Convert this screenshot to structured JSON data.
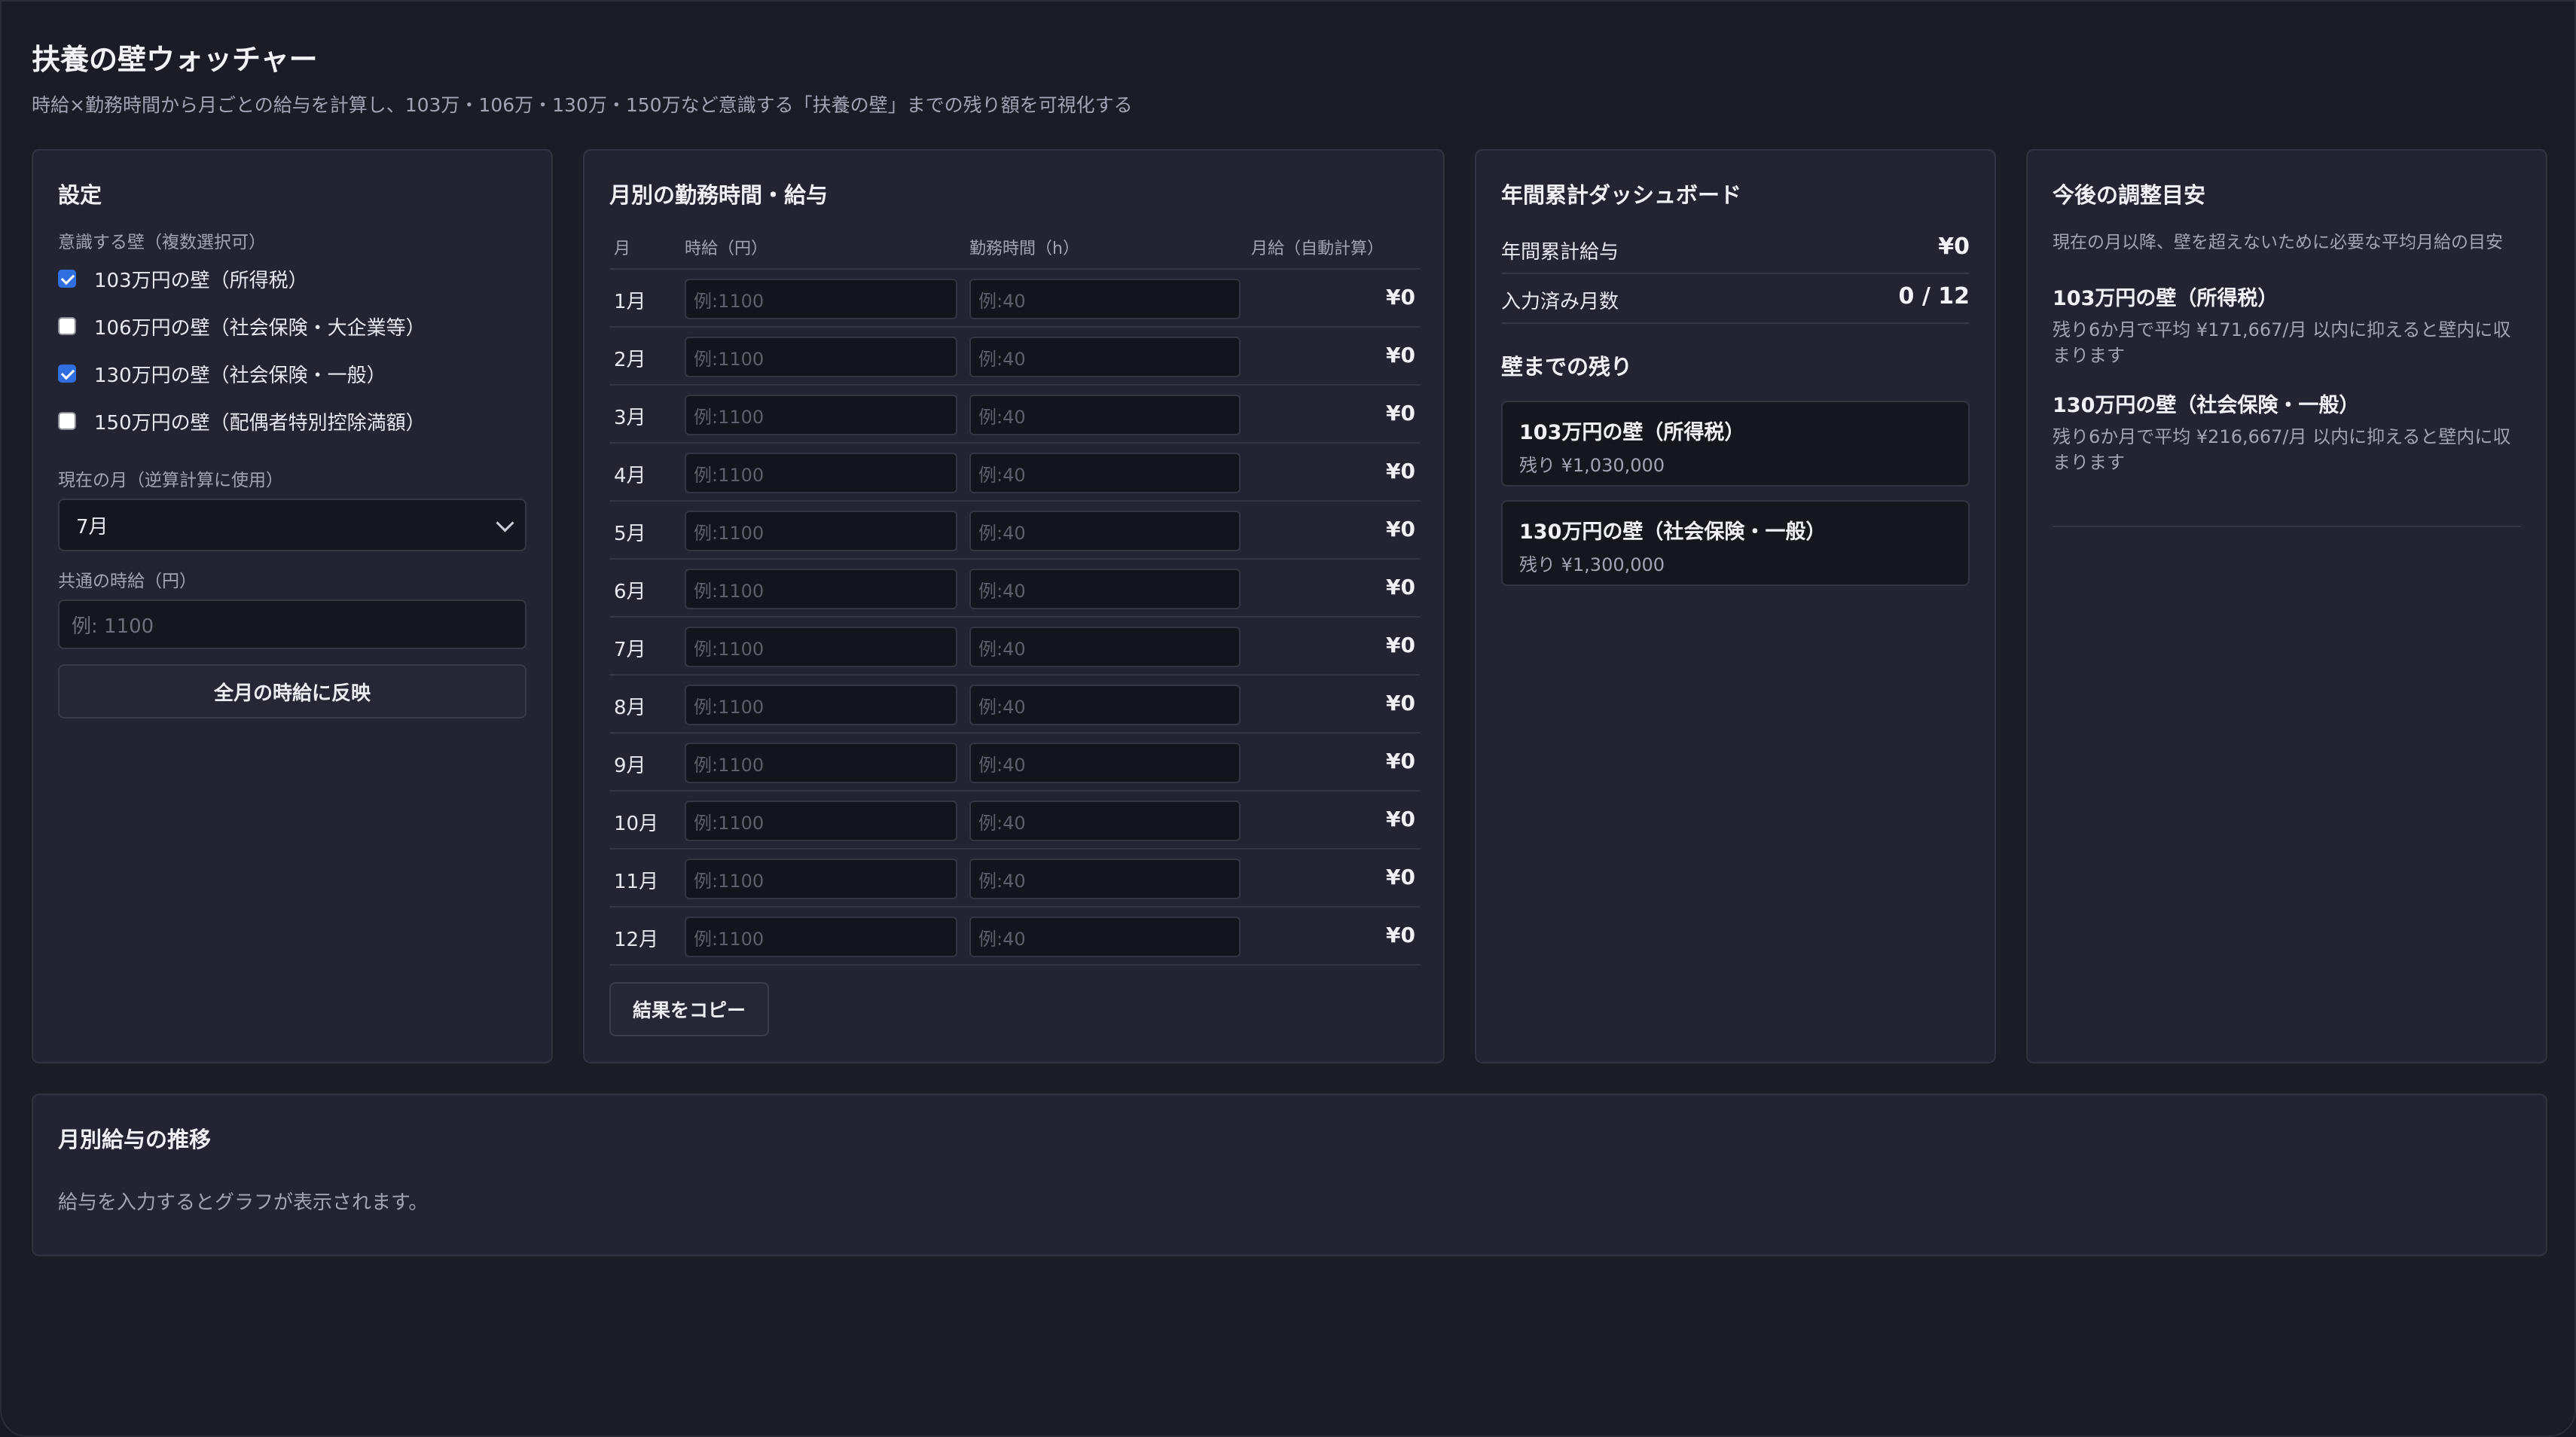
{
  "app": {
    "title": "扶養の壁ウォッチャー",
    "subtitle": "時給×勤務時間から月ごとの給与を計算し、103万・106万・130万・150万など意識する「扶養の壁」までの残り額を可視化する"
  },
  "settings": {
    "title": "設定",
    "walls_label": "意識する壁（複数選択可）",
    "walls": [
      {
        "label": "103万円の壁（所得税）",
        "checked": true
      },
      {
        "label": "106万円の壁（社会保険・大企業等）",
        "checked": false
      },
      {
        "label": "130万円の壁（社会保険・一般）",
        "checked": true
      },
      {
        "label": "150万円の壁（配偶者特別控除満額）",
        "checked": false
      }
    ],
    "current_month_label": "現在の月（逆算計算に使用）",
    "current_month_value": "7月",
    "common_wage_label": "共通の時給（円）",
    "common_wage_placeholder": "例: 1100",
    "apply_button": "全月の時給に反映"
  },
  "monthly": {
    "title": "月別の勤務時間・給与",
    "headers": {
      "month": "月",
      "wage": "時給（円）",
      "hours": "勤務時間（h）",
      "pay": "月給（自動計算）"
    },
    "wage_placeholder": "例:1100",
    "hours_placeholder": "例:40",
    "rows": [
      {
        "month": "1月",
        "pay": "¥0"
      },
      {
        "month": "2月",
        "pay": "¥0"
      },
      {
        "month": "3月",
        "pay": "¥0"
      },
      {
        "month": "4月",
        "pay": "¥0"
      },
      {
        "month": "5月",
        "pay": "¥0"
      },
      {
        "month": "6月",
        "pay": "¥0"
      },
      {
        "month": "7月",
        "pay": "¥0"
      },
      {
        "month": "8月",
        "pay": "¥0"
      },
      {
        "month": "9月",
        "pay": "¥0"
      },
      {
        "month": "10月",
        "pay": "¥0"
      },
      {
        "month": "11月",
        "pay": "¥0"
      },
      {
        "month": "12月",
        "pay": "¥0"
      }
    ],
    "copy_button": "結果をコピー"
  },
  "dashboard": {
    "title": "年間累計ダッシュボード",
    "annual_label": "年間累計給与",
    "annual_value": "¥0",
    "filled_label": "入力済み月数",
    "filled_value": "0 / 12",
    "remaining_title": "壁までの残り",
    "cards": [
      {
        "title": "103万円の壁（所得税）",
        "value": "残り ¥1,030,000"
      },
      {
        "title": "130万円の壁（社会保険・一般）",
        "value": "残り ¥1,300,000"
      }
    ]
  },
  "adjust": {
    "title": "今後の調整目安",
    "desc": "現在の月以降、壁を超えないために必要な平均月給の目安",
    "items": [
      {
        "title": "103万円の壁（所得税）",
        "desc": "残り6か月で平均 ¥171,667/月 以内に抑えると壁内に収まります"
      },
      {
        "title": "130万円の壁（社会保険・一般）",
        "desc": "残り6か月で平均 ¥216,667/月 以内に抑えると壁内に収まります"
      }
    ]
  },
  "chart": {
    "title": "月別給与の推移",
    "empty_text": "給与を入力するとグラフが表示されます。"
  },
  "colors": {
    "accent": "#2f6fe0",
    "background": "#1c1c27",
    "panel": "#232331"
  }
}
